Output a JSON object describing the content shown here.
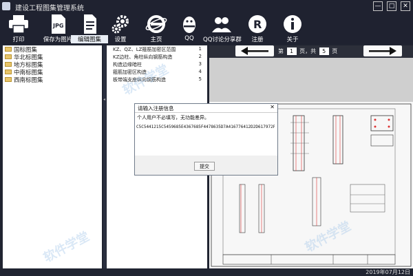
{
  "window": {
    "title": "建设工程图集管理系统",
    "controls": [
      "—",
      "□",
      "✕"
    ]
  },
  "toolbar": {
    "buttons": [
      {
        "label": "打印",
        "icon": "printer-icon"
      },
      {
        "label": "保存为图片",
        "icon": "jpg-file-icon"
      },
      {
        "label": "编辑图集",
        "icon": "document-edit-icon"
      },
      {
        "label": "设置",
        "icon": "gears-icon"
      },
      {
        "label": "主页",
        "icon": "ie-browser-icon"
      },
      {
        "label": "QQ",
        "icon": "qq-penguin-icon"
      },
      {
        "label": "QQ讨论分享群",
        "icon": "group-users-icon"
      },
      {
        "label": "注册",
        "icon": "registered-icon"
      },
      {
        "label": "关于",
        "icon": "info-icon"
      }
    ],
    "jpg_text": "JPG"
  },
  "tree": {
    "items": [
      "国标图集",
      "华北标图集",
      "地方标图集",
      "中南标图集",
      "西南标图集"
    ]
  },
  "documents": {
    "items": [
      {
        "title": "KZ、QZ、LZ箍筋加密区范围",
        "num": "1"
      },
      {
        "title": "KZ边柱、角柱纵向钢筋构造",
        "num": "2"
      },
      {
        "title": "构造边缘暗柱",
        "num": "3"
      },
      {
        "title": "箍筋加密区构造",
        "num": "4"
      },
      {
        "title": "板带端支座纵向钢筋构造",
        "num": "5"
      }
    ]
  },
  "pager": {
    "prefix": "第",
    "current": "1",
    "middle": "页，共",
    "total": "5",
    "suffix": "页"
  },
  "dialog": {
    "title": "请输入注册信息",
    "close": "✕",
    "hint": "个人用户不必填写，无功能差异。",
    "code": "C5C5441215C5459685E4367685F4478635D7A416776412D2D617972F88",
    "submit": "提交"
  },
  "status": {
    "date": "2019年07月12日"
  },
  "splitter": {
    "arrow": "◂"
  },
  "watermark": {
    "text": "软件学堂"
  }
}
